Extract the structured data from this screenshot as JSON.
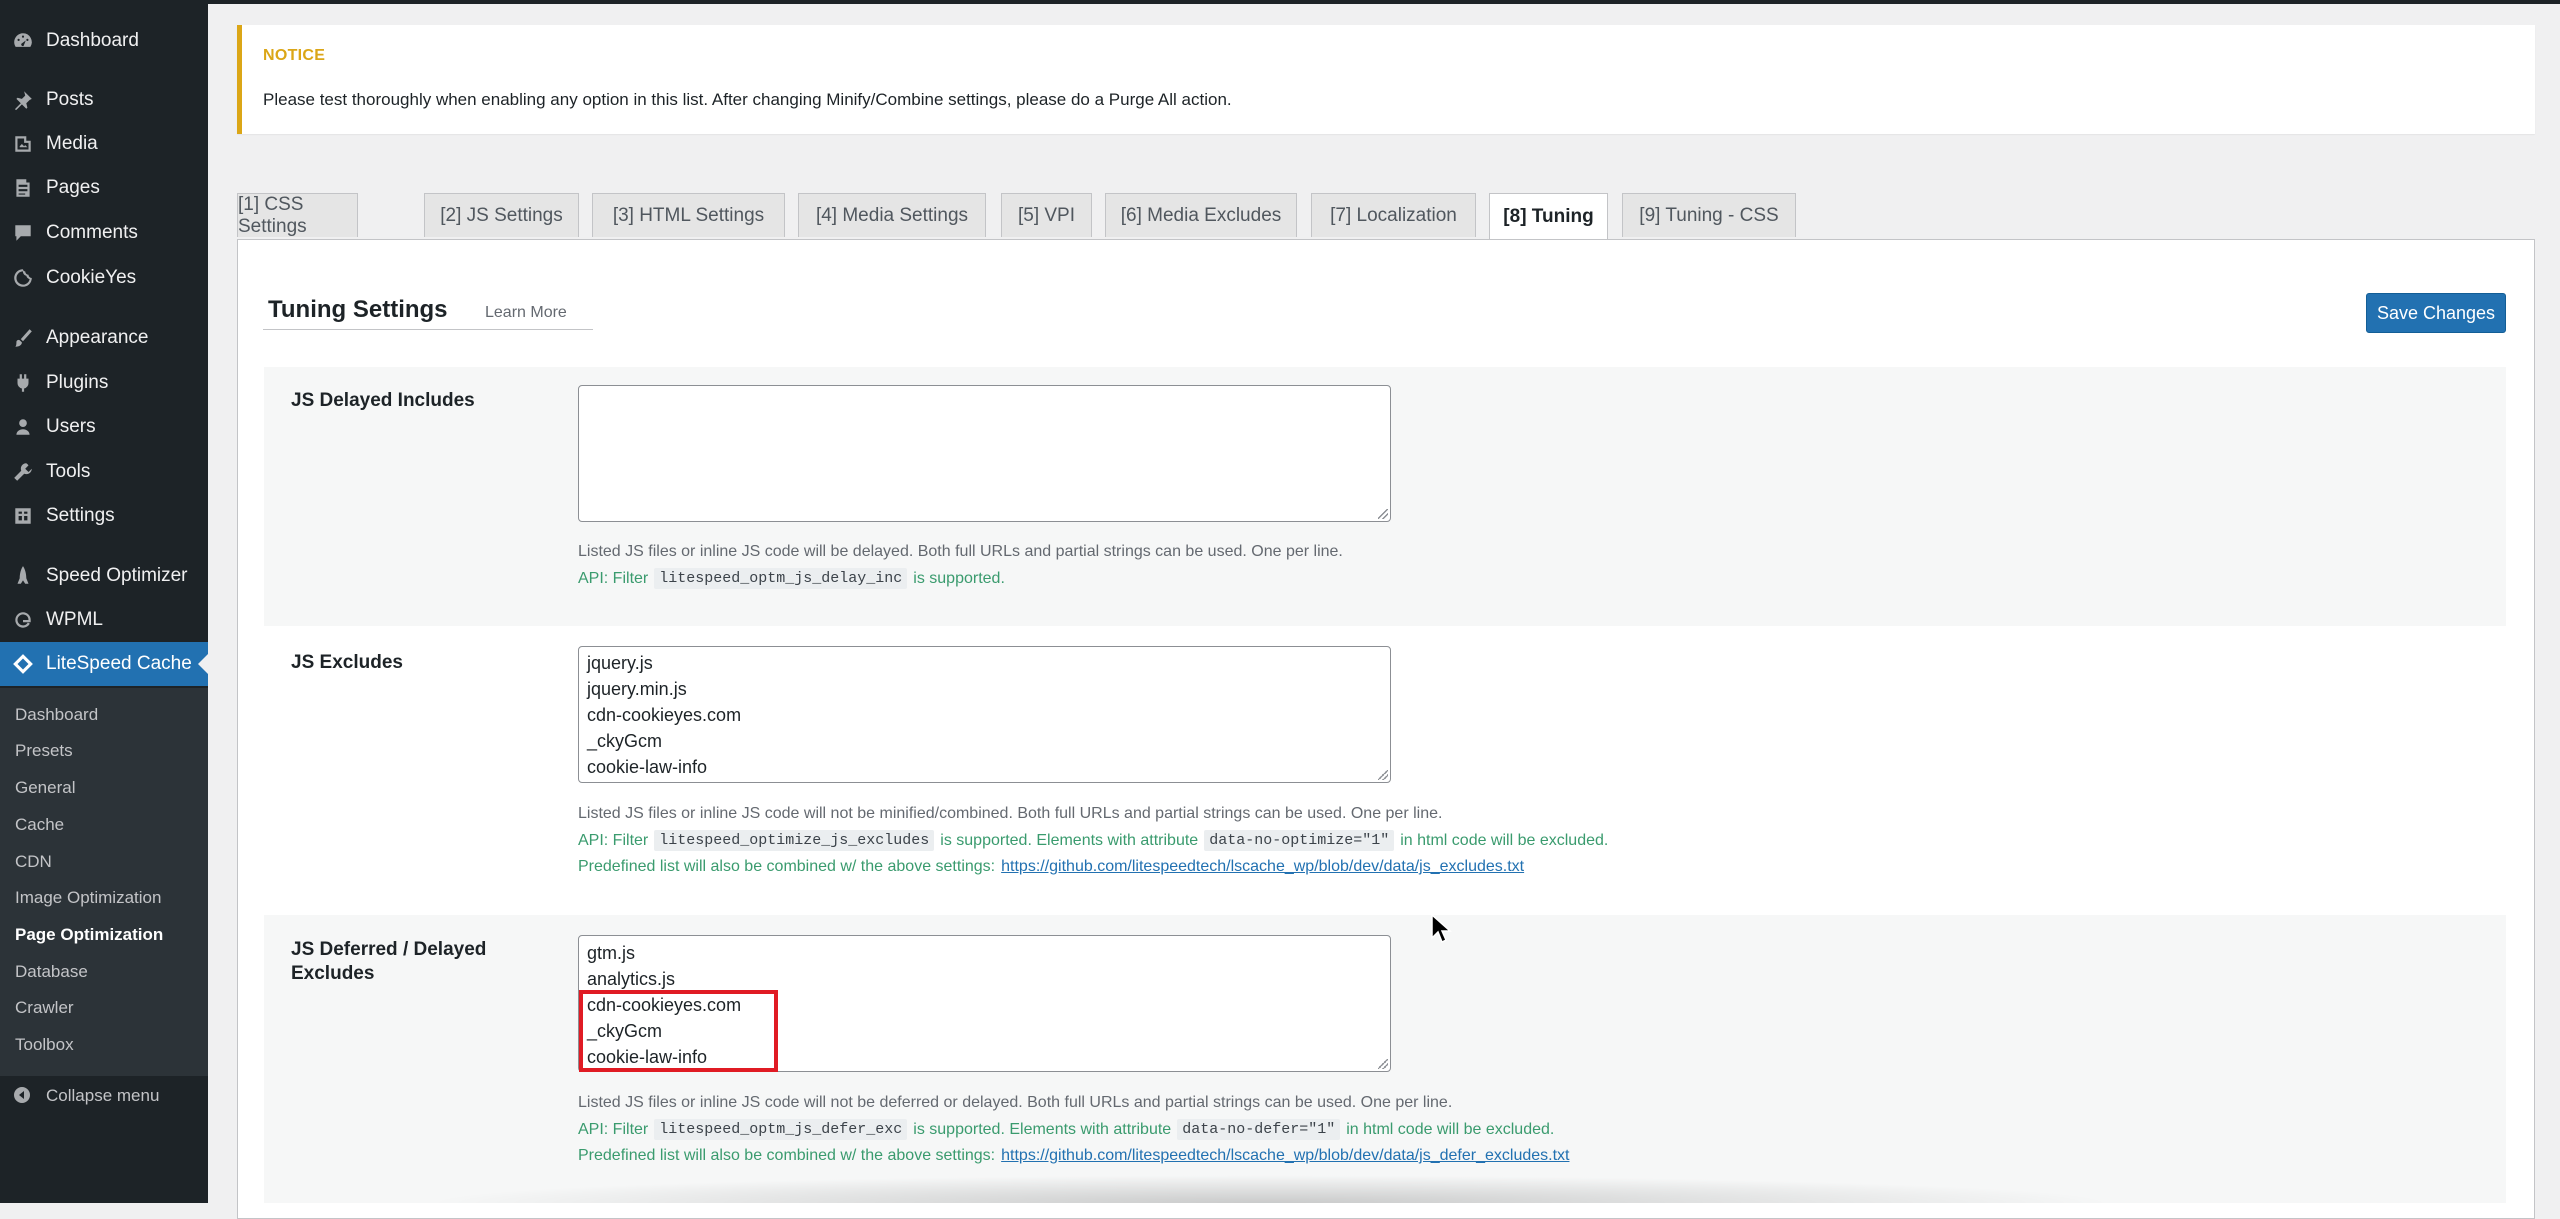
{
  "sidebar": {
    "items": [
      {
        "label": "Dashboard",
        "icon": "dashboard-icon"
      },
      {
        "label": "Posts",
        "icon": "pin-icon"
      },
      {
        "label": "Media",
        "icon": "media-icon"
      },
      {
        "label": "Pages",
        "icon": "page-icon"
      },
      {
        "label": "Comments",
        "icon": "comment-icon"
      },
      {
        "label": "CookieYes",
        "icon": "cookie-icon"
      },
      {
        "label": "Appearance",
        "icon": "brush-icon"
      },
      {
        "label": "Plugins",
        "icon": "plug-icon"
      },
      {
        "label": "Users",
        "icon": "user-icon"
      },
      {
        "label": "Tools",
        "icon": "wrench-icon"
      },
      {
        "label": "Settings",
        "icon": "settings-icon"
      },
      {
        "label": "Speed Optimizer",
        "icon": "rocket-icon"
      },
      {
        "label": "WPML",
        "icon": "wpml-icon"
      },
      {
        "label": "LiteSpeed Cache",
        "icon": "diamond-icon"
      }
    ],
    "submenu": [
      "Dashboard",
      "Presets",
      "General",
      "Cache",
      "CDN",
      "Image Optimization",
      "Page Optimization",
      "Database",
      "Crawler",
      "Toolbox"
    ],
    "collapse_label": "Collapse menu"
  },
  "notice": {
    "title": "NOTICE",
    "text": "Please test thoroughly when enabling any option in this list. After changing Minify/Combine settings, please do a Purge All action."
  },
  "tabs": [
    "[1] CSS Settings",
    "[2] JS Settings",
    "[3] HTML Settings",
    "[4] Media Settings",
    "[5] VPI",
    "[6] Media Excludes",
    "[7] Localization",
    "[8] Tuning",
    "[9] Tuning - CSS"
  ],
  "active_tab": "[8] Tuning",
  "section": {
    "title": "Tuning Settings",
    "learn_more": "Learn More",
    "save_label": "Save Changes"
  },
  "settings": {
    "delayed_includes": {
      "label": "JS Delayed Includes",
      "value": [],
      "desc": "Listed JS files or inline JS code will be delayed. Both full URLs and partial strings can be used. One per line.",
      "api_prefix": "API: Filter",
      "api_code": "litespeed_optm_js_delay_inc",
      "api_suffix": "is supported."
    },
    "excludes": {
      "label": "JS Excludes",
      "value": [
        "jquery.js",
        "jquery.min.js",
        "cdn-cookieyes.com",
        "_ckyGcm",
        "cookie-law-info"
      ],
      "desc": "Listed JS files or inline JS code will not be minified/combined. Both full URLs and partial strings can be used. One per line.",
      "api_prefix": "API: Filter",
      "api_code": "litespeed_optimize_js_excludes",
      "api_mid": "is supported. Elements with attribute",
      "api_attr": "data-no-optimize=\"1\"",
      "api_suffix": "in html code will be excluded.",
      "predefined": "Predefined list will also be combined w/ the above settings:",
      "predefined_url": "https://github.com/litespeedtech/lscache_wp/blob/dev/data/js_excludes.txt"
    },
    "deferred": {
      "label_line1": "JS Deferred / Delayed",
      "label_line2": "Excludes",
      "value": [
        "gtm.js",
        "analytics.js",
        "cdn-cookieyes.com",
        "_ckyGcm",
        "cookie-law-info"
      ],
      "desc": "Listed JS files or inline JS code will not be deferred or delayed. Both full URLs and partial strings can be used. One per line.",
      "api_prefix": "API: Filter",
      "api_code": "litespeed_optm_js_defer_exc",
      "api_mid": "is supported. Elements with attribute",
      "api_attr": "data-no-defer=\"1\"",
      "api_suffix": "in html code will be excluded.",
      "predefined": "Predefined list will also be combined w/ the above settings:",
      "predefined_url": "https://github.com/litespeedtech/lscache_wp/blob/dev/data/js_defer_excludes.txt"
    }
  }
}
